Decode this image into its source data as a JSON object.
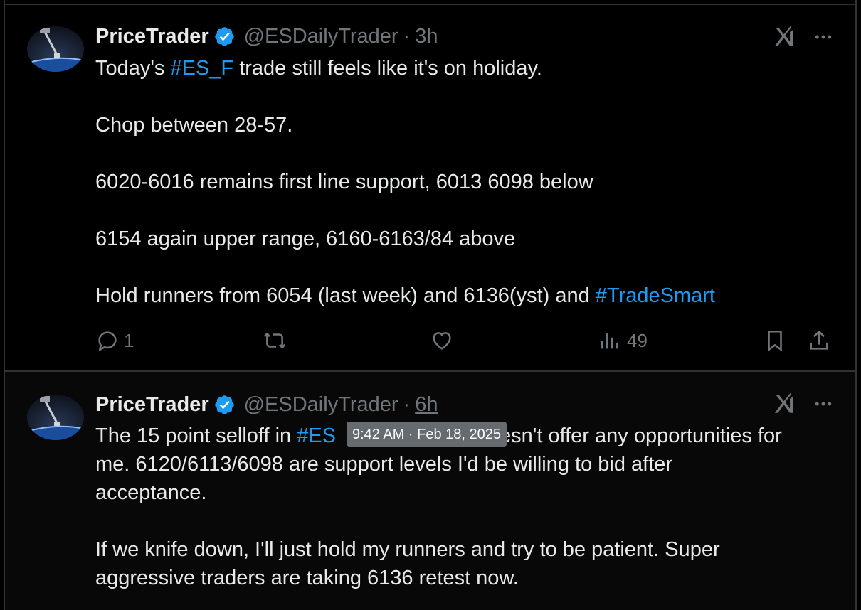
{
  "tweets": [
    {
      "author_name": "PriceTrader",
      "handle": "@ESDailyTrader",
      "separator": "·",
      "time": "3h",
      "lines": [
        {
          "pre": "Today's ",
          "tag": "#ES_F",
          "post": " trade still feels like it's on holiday."
        },
        {
          "text": "Chop between 28-57."
        },
        {
          "text": "6020-6016 remains first line support, 6013 6098 below"
        },
        {
          "text": "6154 again upper range, 6160-6163/84 above"
        },
        {
          "pre": "Hold runners from 6054 (last week) and 6136(yst) and ",
          "tag": "#TradeSmart"
        }
      ],
      "replies": "1",
      "reposts": "",
      "likes": "",
      "views": "49"
    },
    {
      "author_name": "PriceTrader",
      "handle": "@ESDailyTrader",
      "separator": "·",
      "time": "6h",
      "line1_pre": "The 15 point selloff in ",
      "line1_tag": "#ES",
      "line1_post": "esn't offer any opportunities for",
      "line2": "me. 6120/6113/6098 are support levels I'd be willing to bid after",
      "line3": "acceptance.",
      "line4": "If we knife down, I'll just hold my runners and try to be patient. Super",
      "line5": "aggressive traders are taking 6136 retest now.",
      "tooltip": "9:42 AM · Feb 18, 2025"
    }
  ],
  "icons": {
    "verified": "verified-badge-icon",
    "grok": "grok-icon",
    "more": "more-icon",
    "reply": "reply-icon",
    "repost": "repost-icon",
    "like": "heart-icon",
    "views": "views-icon",
    "bookmark": "bookmark-icon",
    "share": "share-icon"
  },
  "colors": {
    "background": "#000000",
    "text": "#e7e9ea",
    "muted": "#71767b",
    "accent": "#1d9bf0",
    "border": "#2f3336"
  }
}
